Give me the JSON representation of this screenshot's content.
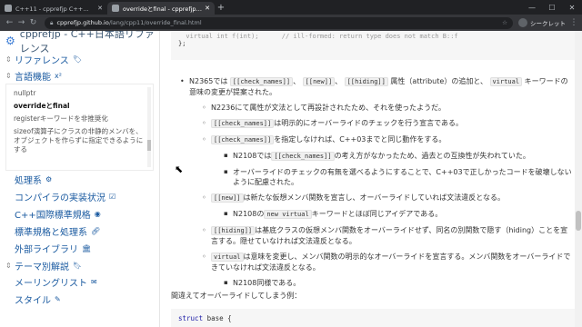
{
  "browser": {
    "tabs": [
      {
        "title": "C++11 - cpprefjp C++日本語リファ"
      },
      {
        "title": "overrideとfinal - cpprefjp C++日本語"
      }
    ],
    "url_host": "cpprefjp.github.io",
    "url_path": "/lang/cpp11/override_final.html",
    "profile": "シークレット"
  },
  "sidebar": {
    "brand": "cpprefjp - C++日本語リファレンス",
    "sections": [
      {
        "label": "リファレンス"
      },
      {
        "label": "言語機能"
      }
    ],
    "sub_items": [
      "nullptr",
      "overrideとfinal",
      "registerキーワードを非推奨化",
      "sizeof演算子にクラスの非静的メンバを、オブジェクトを作らずに指定できるようにする"
    ],
    "children": [
      "処理系",
      "コンパイラの実装状況",
      "C++国際標準規格",
      "標準規格と処理系",
      "外部ライブラリ",
      "テーマ別解説",
      "メーリングリスト",
      "スタイル"
    ]
  },
  "code_top": {
    "line1": "  virtual int f(int);      // ill-formed: return type does not match B::f",
    "line2": "};"
  },
  "content": {
    "p1_a": "N2365では",
    "p1_c1": "[[check_names]]",
    "p1_c2": "[[new]]",
    "p1_c3": "[[hiding]]",
    "p1_b": "属性（attribute）の追加と、",
    "p1_c4": "virtual",
    "p1_d": "キーワードの意味の変更が提案された。",
    "s1": "N2236にて属性が文法として再設計されたため、それを使ったようだ。",
    "s2_c": "[[check_names]]",
    "s2": "は明示的にオーバーライドのチェックを行う宣言である。",
    "s3_c": "[[check_names]]",
    "s3": "を指定しなければ、C++03までと同じ動作をする。",
    "t1_a": "N2108では",
    "t1_c": "[[check_names]]",
    "t1_b": "の考え方がなかったため、過去との互換性が失われていた。",
    "t2": "オーバーライドのチェックの有無を選べるようにすることで、C++03で正しかったコードを破壊しないように配慮された。",
    "s4_c": "[[new]]",
    "s4": "は新たな仮想メンバ関数を宣言し、オーバーライドしていれば文法違反となる。",
    "t3_a": "N2108の",
    "t3_c": "new virtual",
    "t3_b": "キーワードとほぼ同じアイデアである。",
    "s5_c": "[[hiding]]",
    "s5": "は基底クラスの仮想メンバ関数をオーバーライドせず、同名の別関数で隠す（hiding）ことを宣言する。隠せていなければ文法違反となる。",
    "s6_c": "virtual",
    "s6": "は意味を変更し、メンバ関数の明示的なオーバーライドを宣言する。メンバ関数をオーバーライドできていなければ文法違反となる。",
    "t4": "N2108同様である。",
    "mistake": "間違えてオーバーライドしてしまう例："
  },
  "code_bottom": {
    "kw": "struct",
    "rest": " base {"
  }
}
